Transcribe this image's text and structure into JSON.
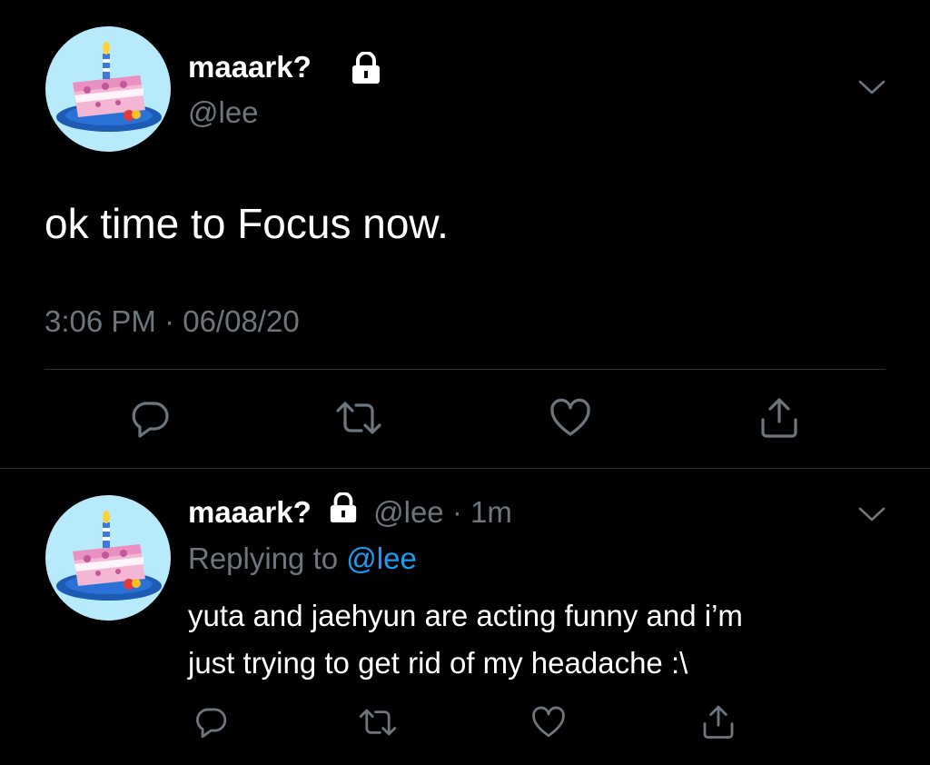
{
  "main_tweet": {
    "display_name": "maaark?",
    "handle": "@lee",
    "text": "ok time to Focus now.",
    "timestamp": "3:06 PM · 06/08/20",
    "icons": [
      "reply-icon",
      "retweet-icon",
      "like-icon",
      "share-icon"
    ]
  },
  "reply_tweet": {
    "display_name": "maaark?",
    "handle": "@lee",
    "separator": "·",
    "age": "1m",
    "replying_to_label": "Replying to",
    "replying_to_handle": "@lee",
    "text_line1": "yuta and jaehyun are acting funny and i’m",
    "text_line2": "just trying to get rid of my headache :\\",
    "icons": [
      "reply-icon",
      "retweet-icon",
      "like-icon",
      "share-icon"
    ]
  },
  "colors": {
    "background": "#000000",
    "text": "#ffffff",
    "muted": "#6e767d",
    "link": "#1d9bf0",
    "avatar_bg": "#b7ebfb"
  }
}
